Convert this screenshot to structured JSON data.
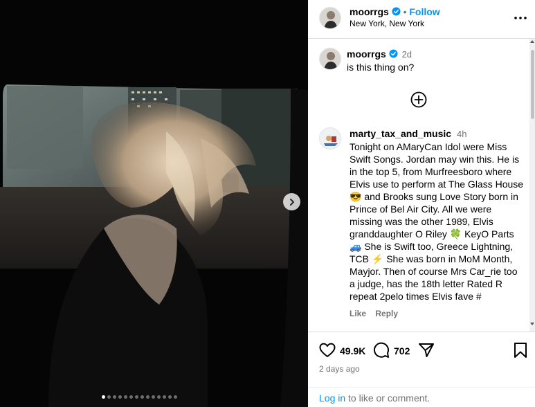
{
  "post": {
    "author": "moorrgs",
    "follow_separator": "•",
    "follow_label": "Follow",
    "location": "New York, New York",
    "more_icon": "more-horizontal-icon",
    "media": {
      "slide_count": 14,
      "active_slide": 1,
      "next_icon": "chevron-right-icon"
    }
  },
  "caption": {
    "author": "moorrgs",
    "time": "2d",
    "text": "is this thing on?"
  },
  "comments": [
    {
      "author": "marty_tax_and_music",
      "time": "4h",
      "lines": [
        "Tonight on AMaryCan Idol were Miss",
        "Swift Songs. Jordan may win this. He is",
        "in the top 5, from Murfreesboro where",
        "Elvis use to perform at The Glass House",
        "😎 and Brooks sung Love Story born in",
        "Prince of Bel Air City. All we were",
        "missing was the other 1989, Elvis",
        "granddaughter O Riley 🍀 KeyO Parts",
        "🚙 She is Swift too, Greece Lightning,",
        "TCB ⚡ She was born in MoM Month,",
        "Mayjor. Then of course Mrs Car_rie too",
        "a judge, has the 18th letter Rated R",
        "repeat 2pelo times Elvis fave #"
      ],
      "like_label": "Like",
      "reply_label": "Reply"
    }
  ],
  "actions": {
    "likes": "49.9K",
    "comments": "702",
    "posted": "2 days ago"
  },
  "login": {
    "link_label": "Log in",
    "suffix": " to like or comment."
  },
  "colors": {
    "accent": "#0095f6",
    "verified": "#0095f6",
    "muted": "#737373"
  }
}
